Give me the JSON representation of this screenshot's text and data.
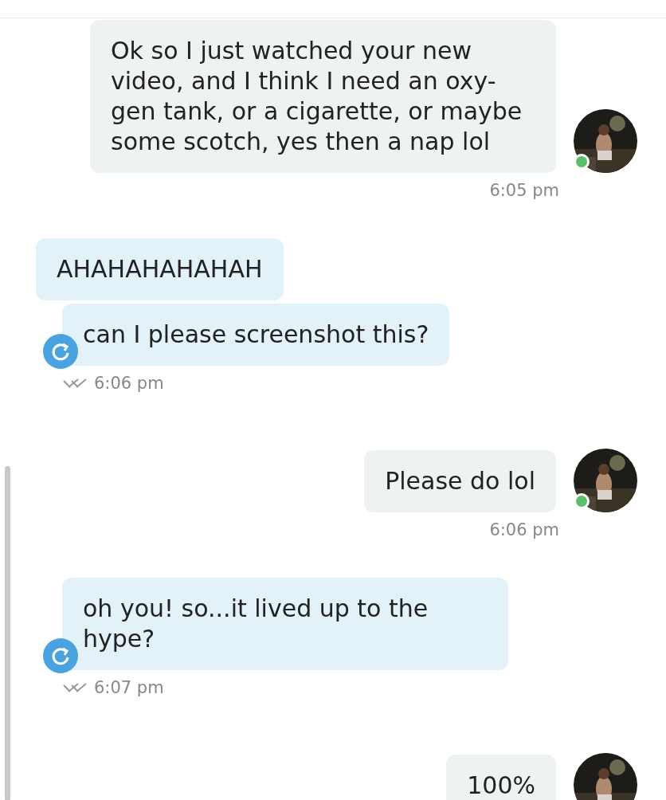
{
  "messages": [
    {
      "kind": "incoming",
      "online": true,
      "bubbles": [
        "Ok so I just watched your new video, and I think I need an oxy-gen tank, or a cigarette, or maybe some scotch, yes then a nap lol"
      ],
      "time": "6:05 pm"
    },
    {
      "kind": "outgoing",
      "read": true,
      "bubbles": [
        "AHAHAHAHAHAH",
        "can I please screenshot this?"
      ],
      "time": "6:06 pm"
    },
    {
      "kind": "incoming",
      "online": true,
      "bubbles": [
        "Please do lol"
      ],
      "time": "6:06 pm"
    },
    {
      "kind": "outgoing",
      "read": true,
      "bubbles": [
        "oh you! so...it lived up to the hype?"
      ],
      "time": "6:07 pm"
    },
    {
      "kind": "incoming",
      "bubbles": [
        "100%"
      ]
    }
  ]
}
